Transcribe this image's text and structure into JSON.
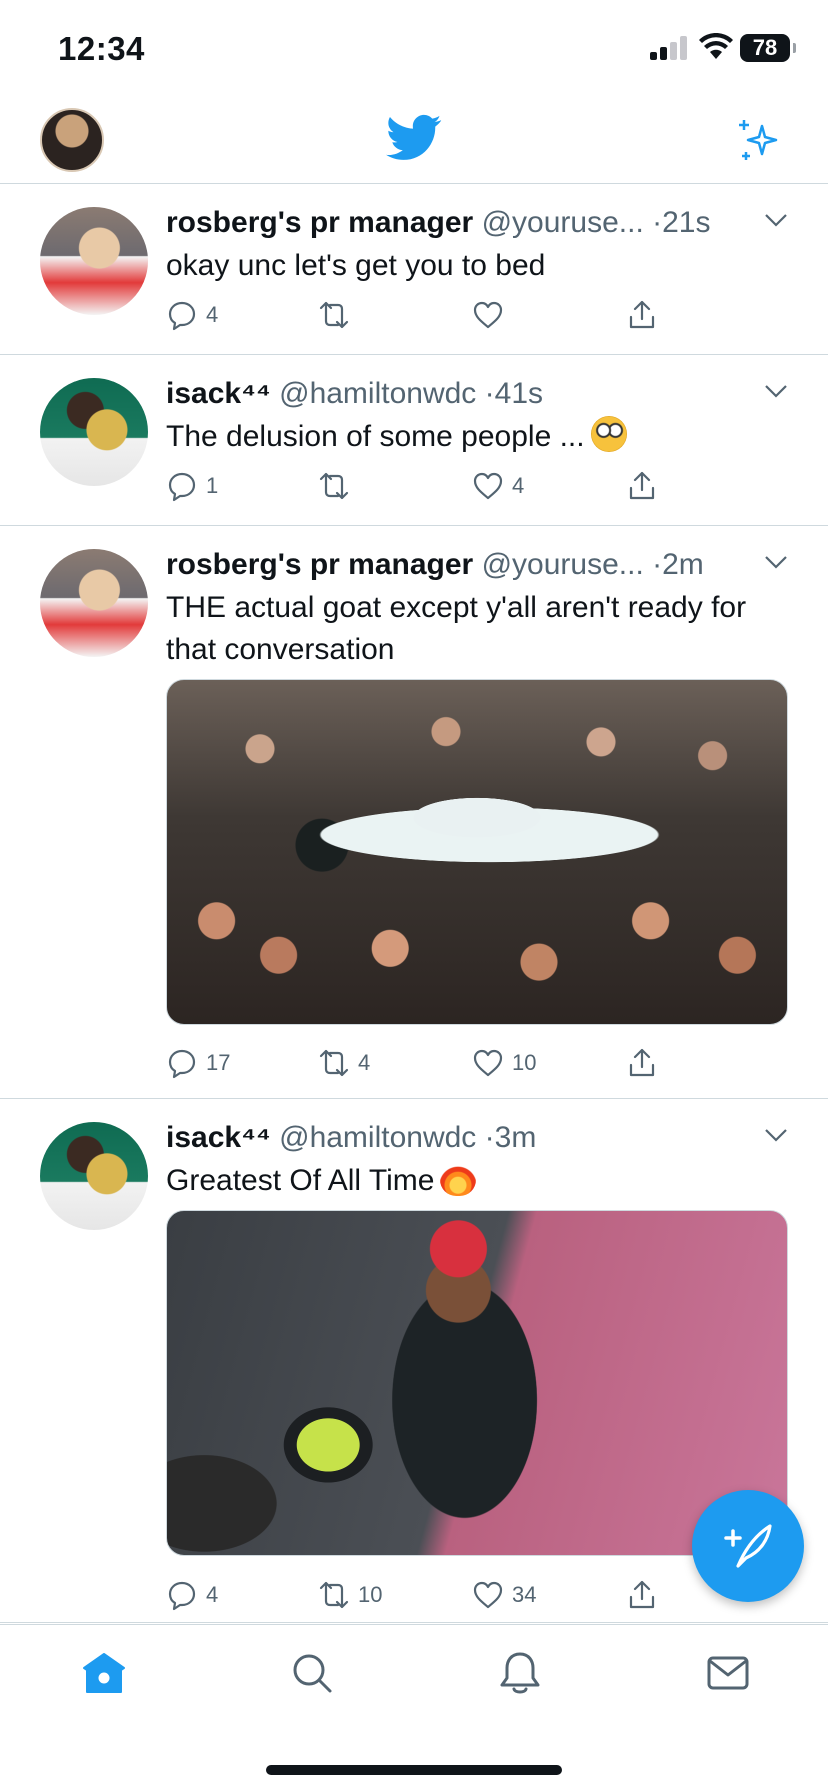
{
  "status_bar": {
    "time": "12:34",
    "battery": "78"
  },
  "header": {
    "logo": "twitter-bird-icon",
    "right_icon": "sparkle-icon"
  },
  "tweets": [
    {
      "name": "rosberg's pr manager",
      "handle": "@youruse...",
      "dot": "·",
      "time": "21s",
      "text": "okay unc let's get you to bed",
      "emoji": "",
      "media": "",
      "reply_count": "4",
      "retweet_count": "",
      "like_count": ""
    },
    {
      "name": "isack⁴⁴",
      "handle": "@hamiltonwdc",
      "dot": "·",
      "time": "41s",
      "text": "The delusion of some people ...",
      "emoji": "face-with-rolling-eyes",
      "media": "",
      "reply_count": "1",
      "retweet_count": "",
      "like_count": "4"
    },
    {
      "name": "rosberg's pr manager",
      "handle": "@youruse...",
      "dot": "·",
      "time": "2m",
      "text": "THE actual goat except y'all aren't ready for that conversation",
      "emoji": "",
      "media": "photo-crowd-celebration",
      "reply_count": "17",
      "retweet_count": "4",
      "like_count": "10"
    },
    {
      "name": "isack⁴⁴",
      "handle": "@hamiltonwdc",
      "dot": "·",
      "time": "3m",
      "text": "Greatest Of All Time",
      "emoji": "fire",
      "media": "photo-driver-seated",
      "reply_count": "4",
      "retweet_count": "10",
      "like_count": "34"
    }
  ],
  "fab": {
    "icon": "compose-tweet-icon"
  },
  "tab_bar": {
    "items": [
      "home-icon",
      "search-icon",
      "notifications-bell-icon",
      "messages-envelope-icon"
    ],
    "active": "home-icon"
  },
  "colors": {
    "accent": "#1d9bf0",
    "text": "#0f1419",
    "secondary": "#536471",
    "divider": "#cfd9de"
  }
}
